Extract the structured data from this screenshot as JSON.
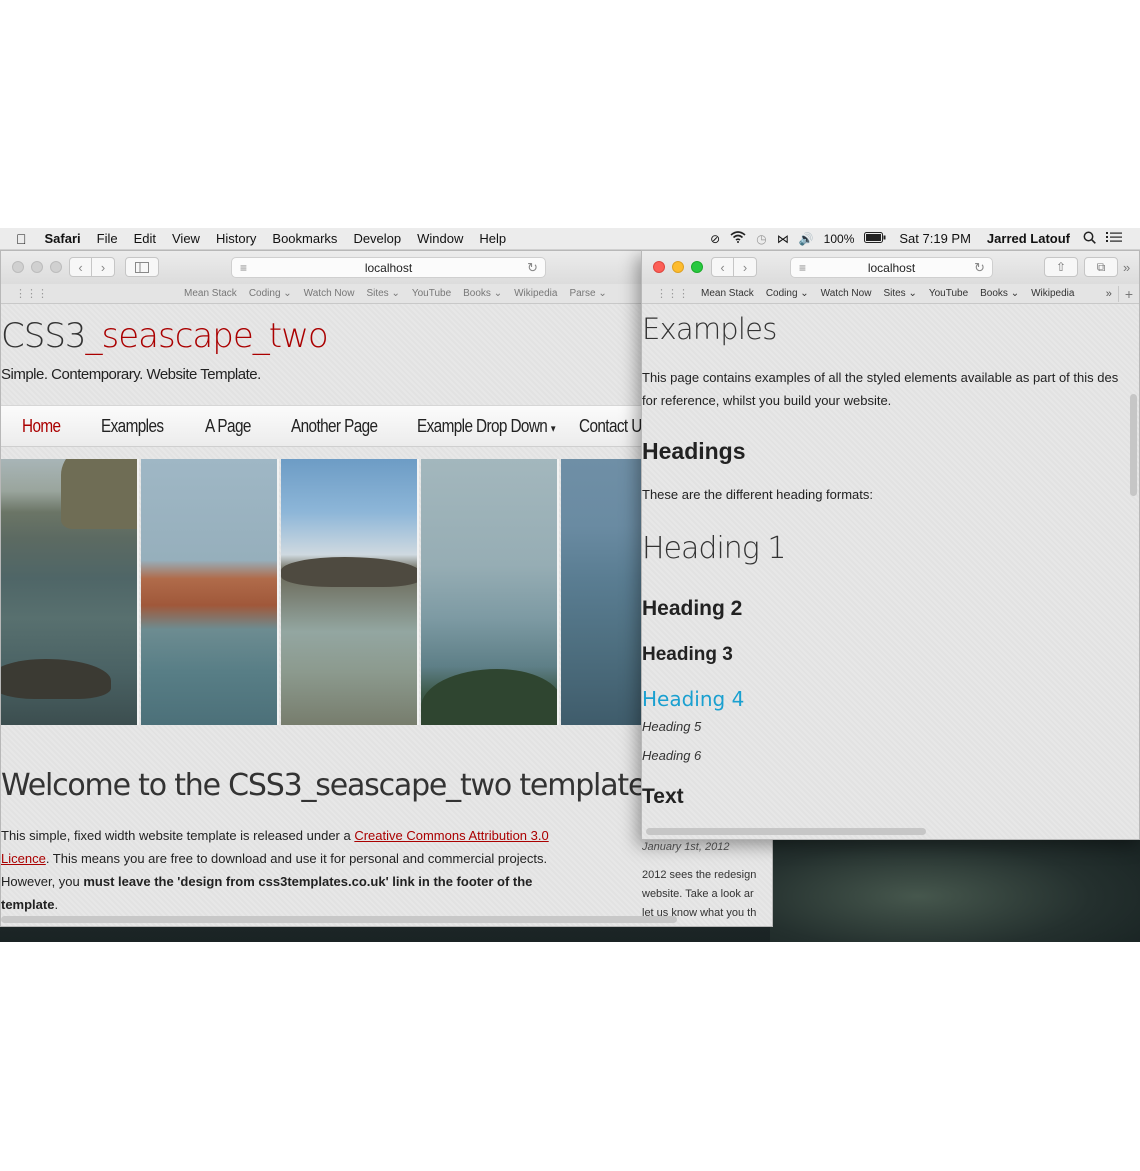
{
  "menubar": {
    "app": "Safari",
    "items": [
      "File",
      "Edit",
      "View",
      "History",
      "Bookmarks",
      "Develop",
      "Window",
      "Help"
    ],
    "battery": "100%",
    "clock": "Sat 7:19 PM",
    "user": "Jarred Latouf"
  },
  "left_window": {
    "url": "localhost",
    "favorites": [
      "Mean Stack",
      "Coding ⌄",
      "Watch Now",
      "Sites ⌄",
      "YouTube",
      "Books ⌄",
      "Wikipedia",
      "Parse ⌄"
    ],
    "site_title_main": "CSS3",
    "site_title_accent": "_seascape_two",
    "site_subtitle": "Simple. Contemporary. Website Template.",
    "nav": [
      "Home",
      "Examples",
      "A Page",
      "Another Page",
      "Example Drop Down",
      "Contact Us"
    ],
    "welcome_heading": "Welcome to the CSS3_seascape_two template",
    "para": {
      "t1": "This simple, fixed width website template is released under a ",
      "link1": "Creative Commons Attribution 3.0",
      "link2": "Licence",
      "t2": ". This means you are free to download and use it for personal and commercial projects.",
      "t3": "However, you ",
      "bold": "must leave the 'design from css3templates.co.uk' link in the footer of the",
      "bold2": "template",
      "t4": "."
    },
    "peek": {
      "date": "January 1st, 2012",
      "l1": "2012 sees the redesign",
      "l2": "website. Take a look ar",
      "l3": "let us know what you th"
    }
  },
  "right_window": {
    "url": "localhost",
    "favorites": [
      "Mean Stack",
      "Coding ⌄",
      "Watch Now",
      "Sites ⌄",
      "YouTube",
      "Books ⌄",
      "Wikipedia"
    ],
    "title": "Examples",
    "para_line1": "This page contains examples of all the styled elements available as part of this des",
    "para_line2": "for reference, whilst you build your website.",
    "headings_title": "Headings",
    "headings_note": "These are the different heading formats:",
    "h1": "Heading 1",
    "h2": "Heading 2",
    "h3": "Heading 3",
    "h4": "Heading 4",
    "h5": "Heading 5",
    "h6": "Heading 6",
    "text_title": "Text"
  },
  "colors": {
    "accent_red": "#aa0000",
    "heading4_blue": "#1aa0d0"
  },
  "icons": [
    "apple-icon",
    "wifi-icon",
    "volume-icon",
    "search-icon",
    "list-icon",
    "back-icon",
    "forward-icon",
    "sidebar-icon",
    "reader-icon",
    "reload-icon",
    "share-icon",
    "tabs-icon",
    "grid-icon"
  ]
}
